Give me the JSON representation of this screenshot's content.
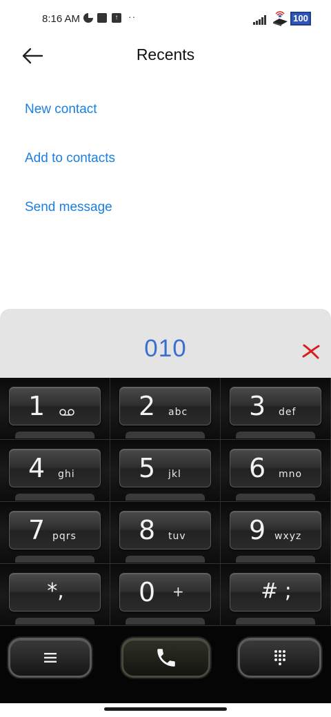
{
  "status_bar": {
    "time": "8:16 AM",
    "battery": "100",
    "icons": [
      "do-not-disturb-icon",
      "notification-square-icon",
      "upload-icon",
      "more-notifications-icon",
      "signal-icon",
      "wifi-router-icon",
      "battery-icon"
    ]
  },
  "header": {
    "title": "Recents",
    "back_icon": "arrow-left-icon"
  },
  "actions": {
    "new_contact": "New contact",
    "add_to_contacts": "Add to contacts",
    "send_message": "Send message"
  },
  "dialer": {
    "number": "010",
    "delete_icon": "backspace-x-icon",
    "accent_color": "#3a6ed0",
    "keys": [
      {
        "digit": "1",
        "letters": "",
        "icon": "voicemail-icon"
      },
      {
        "digit": "2",
        "letters": "abc"
      },
      {
        "digit": "3",
        "letters": "def"
      },
      {
        "digit": "4",
        "letters": "ghi"
      },
      {
        "digit": "5",
        "letters": "jkl"
      },
      {
        "digit": "6",
        "letters": "mno"
      },
      {
        "digit": "7",
        "letters": "pqrs"
      },
      {
        "digit": "8",
        "letters": "tuv"
      },
      {
        "digit": "9",
        "letters": "wxyz"
      },
      {
        "digit": "",
        "symbol": "*,"
      },
      {
        "digit": "0",
        "letters": "+"
      },
      {
        "digit": "",
        "symbol": "# ;"
      }
    ]
  },
  "bottom_bar": {
    "menu_icon": "menu-icon",
    "call_icon": "phone-icon",
    "dialpad_icon": "dialpad-icon"
  },
  "colors": {
    "link": "#1a7fe0",
    "number": "#3a6ed0",
    "delete": "#d42020"
  }
}
